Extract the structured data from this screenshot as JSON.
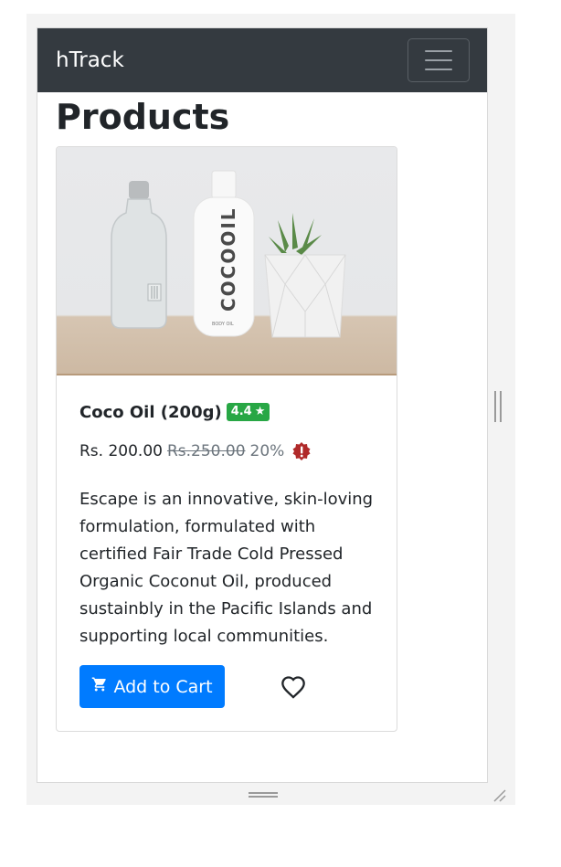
{
  "navbar": {
    "brand": "hTrack",
    "toggle_icon": "hamburger-icon"
  },
  "page": {
    "title": "Products"
  },
  "products": [
    {
      "name": "Coco Oil (200g)",
      "rating": "4.4",
      "rating_icon": "star-icon",
      "price": "Rs. 200.00",
      "original_price": "Rs.250.00",
      "discount": "20%",
      "discount_icon": "alert-badge-icon",
      "description": "Escape is an innovative, skin-loving formulation, formulated with certified Fair Trade Cold Pressed Organic Coconut Oil, produced sustainbly in the Pacific Islands and supporting local communities.",
      "bottle_label": "COCOOIL",
      "bottle_sublabel": "BODY OIL",
      "add_to_cart_label": "Add to Cart",
      "cart_icon": "cart-icon",
      "wishlist_icon": "heart-icon"
    }
  ],
  "colors": {
    "navbar_bg": "#343a40",
    "primary": "#007bff",
    "rating_badge": "#28a745",
    "alert": "#b02a2a"
  }
}
